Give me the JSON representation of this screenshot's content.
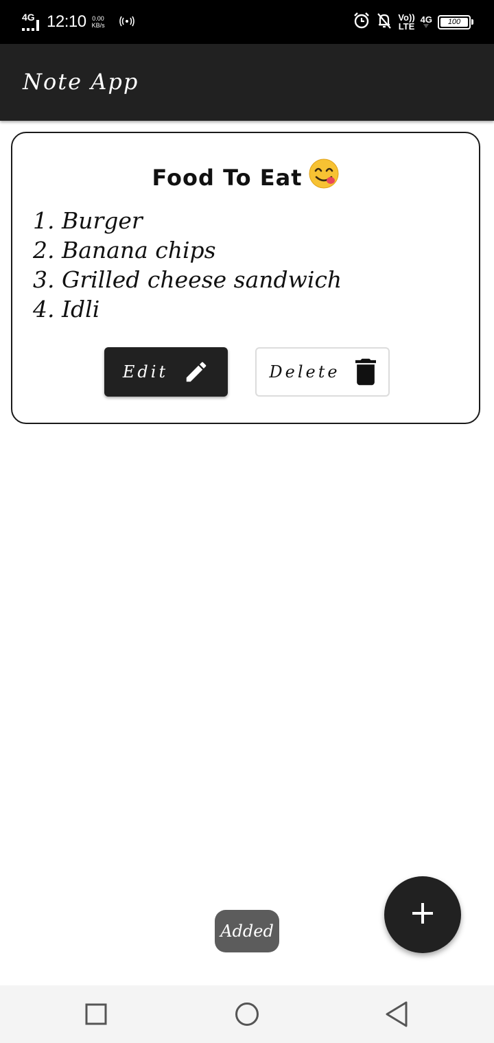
{
  "status_bar": {
    "network_type": "4G",
    "time": "12:10",
    "speed_value": "0.00",
    "speed_unit": "KB/s",
    "volte_top": "Vo))",
    "volte_bottom": "LTE",
    "net_right": "4G",
    "battery_level": "100",
    "icons": [
      "signal-icon",
      "hotspot-icon",
      "alarm-icon",
      "notifications-off-icon",
      "battery-icon"
    ]
  },
  "app_bar": {
    "title": "Note App"
  },
  "note": {
    "title": "Food To Eat",
    "emoji": "😋",
    "lines": [
      "1. Burger",
      "2. Banana chips",
      "3. Grilled cheese sandwich",
      "4. Idli"
    ],
    "edit_label": "Edit",
    "delete_label": "Delete"
  },
  "toast": {
    "message": "Added"
  },
  "colors": {
    "app_bar": "#212121",
    "status_bar": "#000000",
    "toast": "#5c5c5c",
    "nav_bar": "#f4f4f4"
  }
}
